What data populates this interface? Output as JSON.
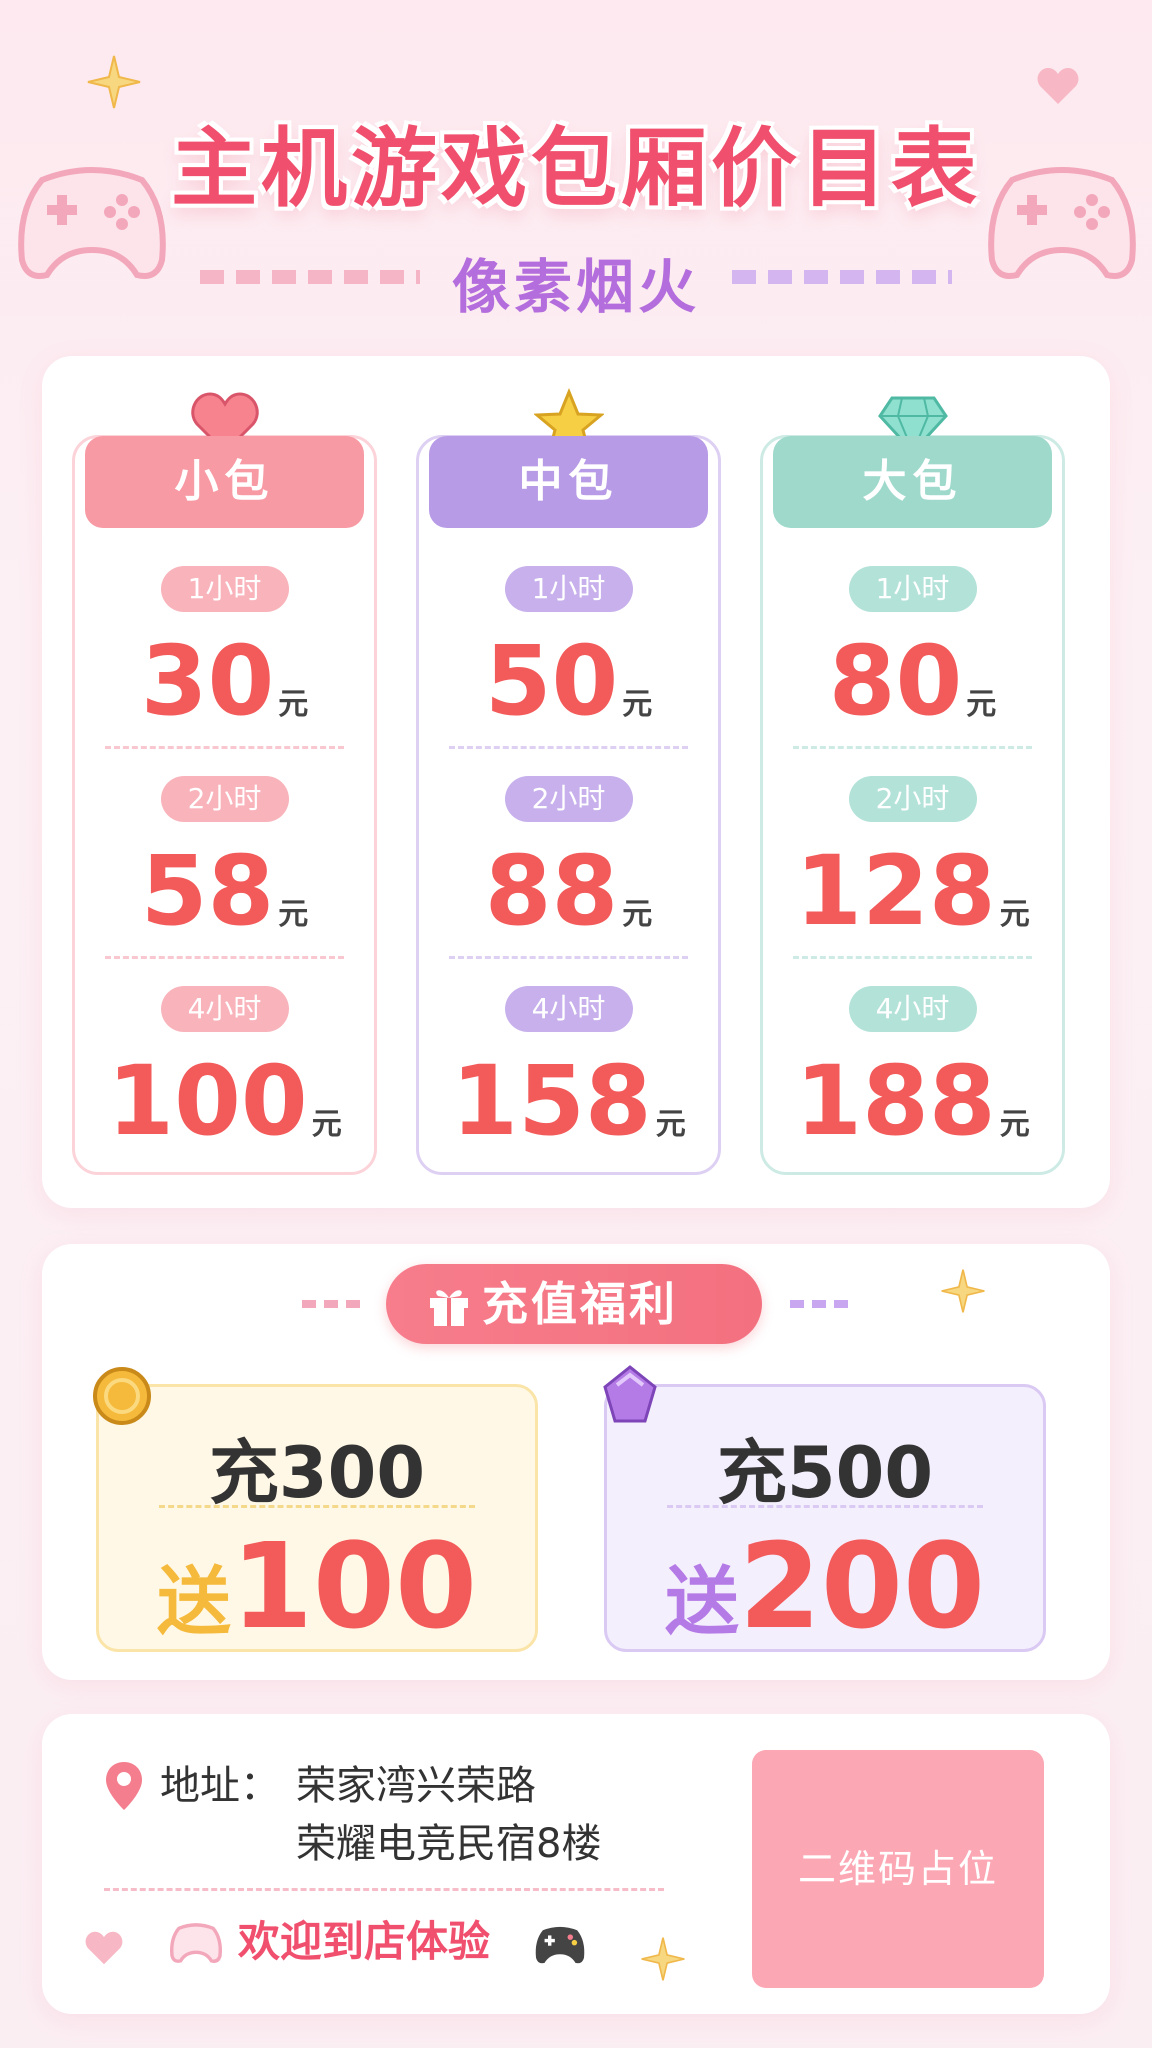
{
  "header": {
    "title": "主机游戏包厢价目表",
    "subtitle": "像素烟火"
  },
  "packages": [
    {
      "name": "小包",
      "icon": "heart-icon",
      "color": "#f79aa4",
      "tiers": [
        {
          "duration": "1小时",
          "price": "30",
          "unit": "元"
        },
        {
          "duration": "2小时",
          "price": "58",
          "unit": "元"
        },
        {
          "duration": "4小时",
          "price": "100",
          "unit": "元"
        }
      ]
    },
    {
      "name": "中包",
      "icon": "star-icon",
      "color": "#b89be6",
      "tiers": [
        {
          "duration": "1小时",
          "price": "50",
          "unit": "元"
        },
        {
          "duration": "2小时",
          "price": "88",
          "unit": "元"
        },
        {
          "duration": "4小时",
          "price": "158",
          "unit": "元"
        }
      ]
    },
    {
      "name": "大包",
      "icon": "diamond-icon",
      "color": "#9fd9cc",
      "tiers": [
        {
          "duration": "1小时",
          "price": "80",
          "unit": "元"
        },
        {
          "duration": "2小时",
          "price": "128",
          "unit": "元"
        },
        {
          "duration": "4小时",
          "price": "188",
          "unit": "元"
        }
      ]
    }
  ],
  "recharge": {
    "title": "充值福利",
    "offers": [
      {
        "charge": "充300",
        "gift_label": "送",
        "gift_amount": "100",
        "icon": "coin-icon",
        "color": "#f5b93b"
      },
      {
        "charge": "充500",
        "gift_label": "送",
        "gift_amount": "200",
        "icon": "purple-gem-icon",
        "color": "#b47ae6"
      }
    ]
  },
  "footer": {
    "address_label": "地址：",
    "address_line1": "荣家湾兴荣路",
    "address_line2": "荣耀电竞民宿8楼",
    "welcome": "欢迎到店体验",
    "qr_placeholder": "二维码占位"
  },
  "colors": {
    "price": "#f35a5a",
    "title": "#f0506e",
    "subtitle": "#b46ddc"
  }
}
